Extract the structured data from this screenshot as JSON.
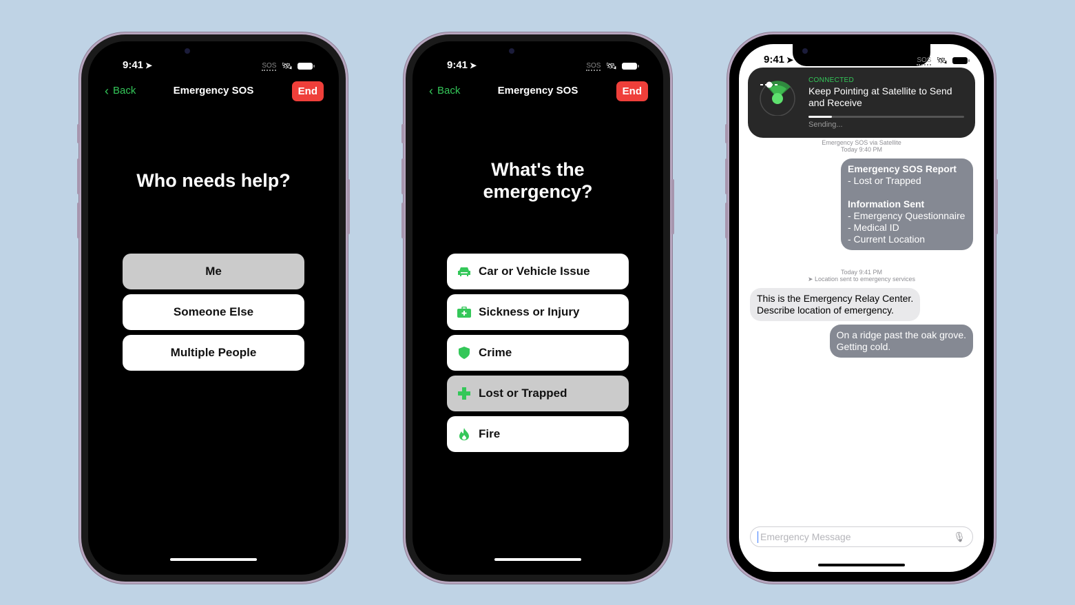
{
  "status": {
    "time": "9:41",
    "sos_label": "SOS"
  },
  "colors": {
    "background": "#bfd3e5",
    "accent_green": "#34c759",
    "end_red": "#ef3f3a",
    "selected_option": "#cbcbcb",
    "outgoing_bubble": "#858993",
    "incoming_bubble": "#e9e9eb"
  },
  "phone1": {
    "nav": {
      "back": "Back",
      "title": "Emergency SOS",
      "end": "End"
    },
    "question": "Who needs help?",
    "options": [
      {
        "label": "Me",
        "selected": true
      },
      {
        "label": "Someone Else",
        "selected": false
      },
      {
        "label": "Multiple People",
        "selected": false
      }
    ]
  },
  "phone2": {
    "nav": {
      "back": "Back",
      "title": "Emergency SOS",
      "end": "End"
    },
    "question_line1": "What's the",
    "question_line2": "emergency?",
    "options": [
      {
        "label": "Car or Vehicle Issue",
        "icon": "car-icon",
        "selected": false
      },
      {
        "label": "Sickness or Injury",
        "icon": "medical-kit-icon",
        "selected": false
      },
      {
        "label": "Crime",
        "icon": "shield-icon",
        "selected": false
      },
      {
        "label": "Lost or Trapped",
        "icon": "cross-icon",
        "selected": true
      },
      {
        "label": "Fire",
        "icon": "flame-icon",
        "selected": false
      }
    ]
  },
  "phone3": {
    "banner": {
      "status": "CONNECTED",
      "message": "Keep Pointing at Satellite to Send and Receive",
      "progress": 0.15,
      "progress_label": "Sending..."
    },
    "meta1_line1": "Emergency SOS via Satellite",
    "meta1_line2": "Today 9:40 PM",
    "report": {
      "title": "Emergency SOS Report",
      "line1": "- Lost or Trapped",
      "info_title": "Information Sent",
      "info_items": [
        "- Emergency Questionnaire",
        "- Medical ID",
        "- Current Location"
      ]
    },
    "meta2_line1": "Today 9:41 PM",
    "meta2_line2": "Location sent to emergency services",
    "incoming": {
      "line1": "This is the Emergency Relay Center.",
      "line2": "Describe location of emergency."
    },
    "outgoing": {
      "line1": "On a ridge past the oak grove.",
      "line2": "Getting cold."
    },
    "composer": {
      "placeholder": "Emergency Message",
      "value": ""
    }
  }
}
